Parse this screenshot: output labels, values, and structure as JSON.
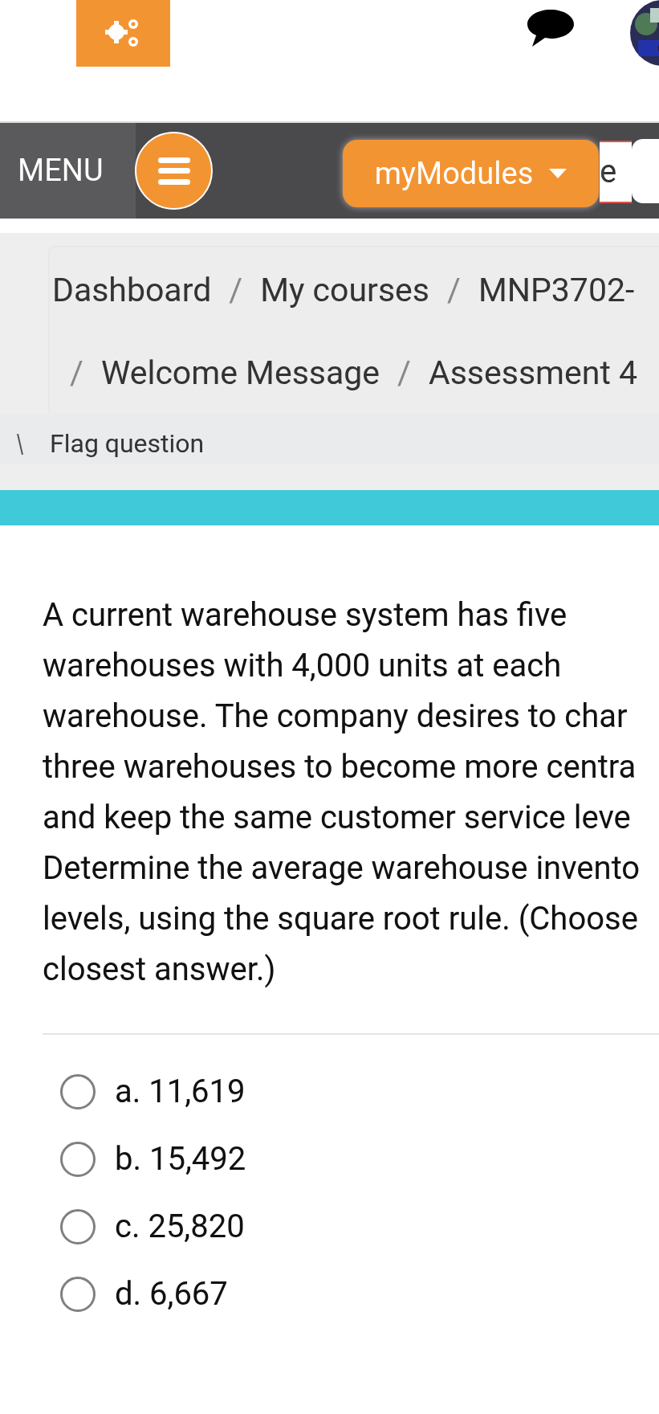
{
  "header": {
    "menu_label": "MENU",
    "modules_button": "myModules",
    "search_field_text": "e"
  },
  "breadcrumb": [
    {
      "label": "Dashboard"
    },
    {
      "separator": "/",
      "label": "My courses"
    },
    {
      "separator": "/",
      "label": "MNP3702-"
    },
    {
      "separator": "/",
      "label": "Welcome Message"
    },
    {
      "separator": "/",
      "label": "Assessment 4"
    }
  ],
  "flag_question": "Flag question",
  "question": {
    "lines": [
      "A current warehouse system has five",
      "warehouses with 4,000 units at each",
      "warehouse. The company desires to char",
      "three warehouses to become more centra",
      "and keep the same customer service leve",
      "Determine the average warehouse invento",
      "levels, using the square root rule. (Choose",
      "closest answer.)"
    ]
  },
  "options": [
    {
      "label": "a. 11,619",
      "selected": false
    },
    {
      "label": "b. 15,492",
      "selected": false
    },
    {
      "label": "c. 25,820",
      "selected": false
    },
    {
      "label": "d. 6,667",
      "selected": false
    }
  ]
}
